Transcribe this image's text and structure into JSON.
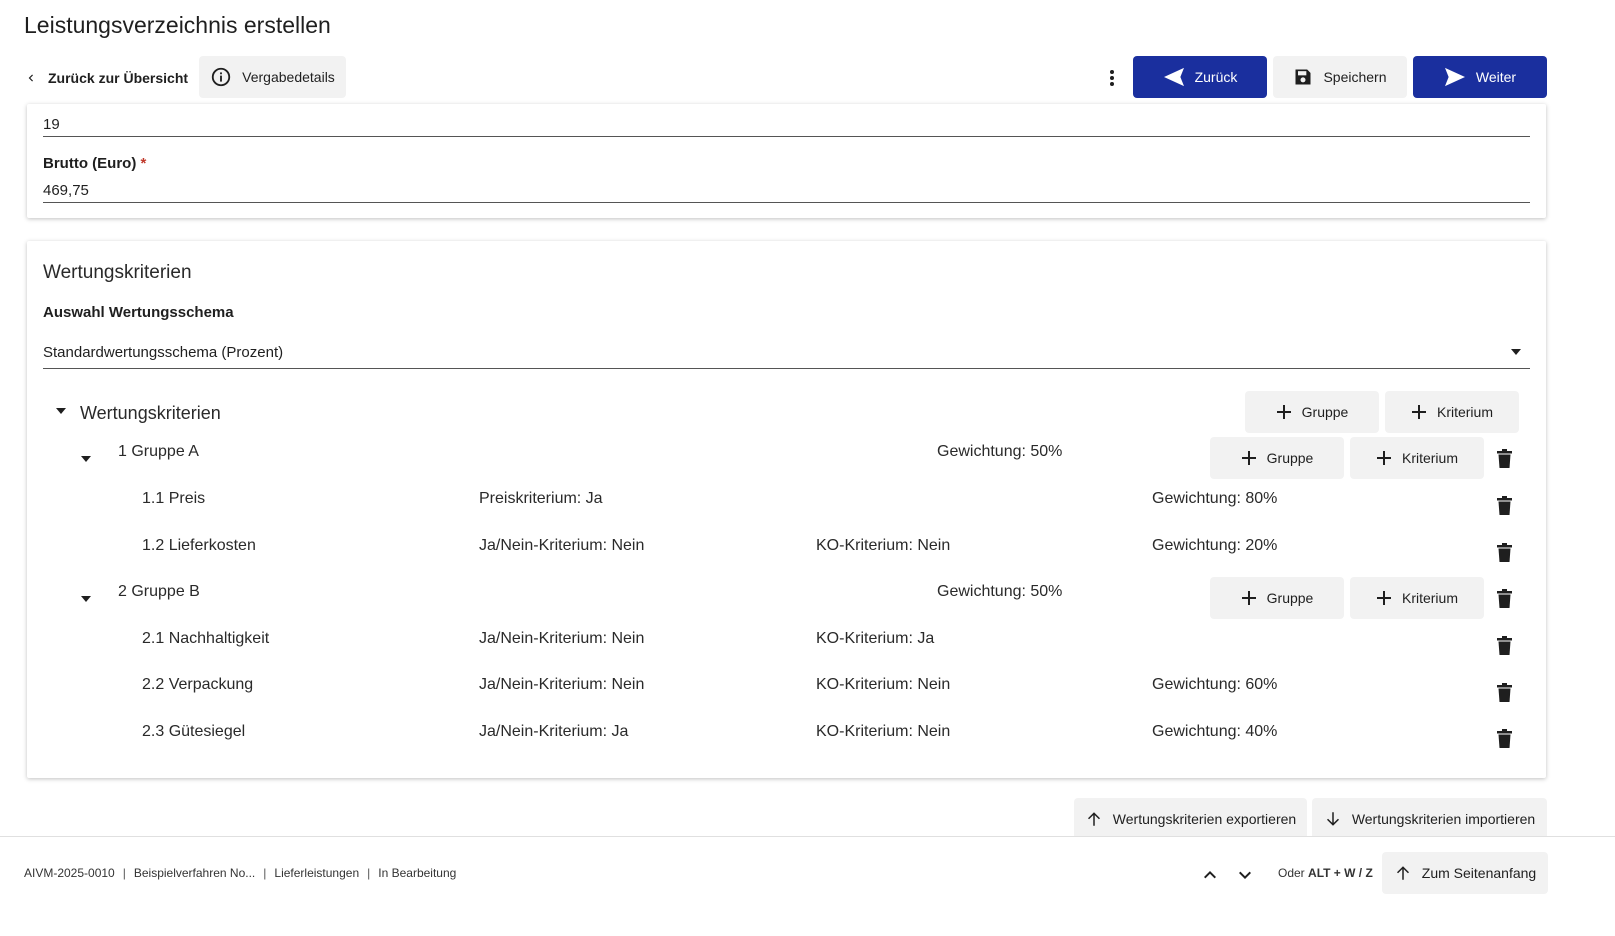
{
  "header": {
    "title": "Leistungsverzeichnis erstellen",
    "back_label": "Zurück zur Übersicht",
    "vergabedetails_label": "Vergabedetails",
    "zurueck_label": "Zurück",
    "speichern_label": "Speichern",
    "weiter_label": "Weiter"
  },
  "price_card": {
    "tax_value": "19",
    "brutto_label": "Brutto (Euro)",
    "required_mark": "*",
    "brutto_value": "469,75"
  },
  "criteria_card": {
    "title": "Wertungskriterien",
    "schema_label": "Auswahl Wertungsschema",
    "schema_value": "Standardwertungsschema (Prozent)",
    "root_label": "Wertungskriterien",
    "add_group_label": "Gruppe",
    "add_criterion_label": "Kriterium",
    "groups": [
      {
        "label": "1 Gruppe A",
        "weight": "Gewichtung: 50%",
        "criteria": [
          {
            "label": "1.1 Preis",
            "col1": "Preiskriterium: Ja",
            "col2": "",
            "weight": "Gewichtung: 80%"
          },
          {
            "label": "1.2 Lieferkosten",
            "col1": "Ja/Nein-Kriterium: Nein",
            "col2": "KO-Kriterium: Nein",
            "weight": "Gewichtung: 20%"
          }
        ]
      },
      {
        "label": "2 Gruppe B",
        "weight": "Gewichtung: 50%",
        "criteria": [
          {
            "label": "2.1 Nachhaltigkeit",
            "col1": "Ja/Nein-Kriterium: Nein",
            "col2": "KO-Kriterium: Ja",
            "weight": ""
          },
          {
            "label": "2.2 Verpackung",
            "col1": "Ja/Nein-Kriterium: Nein",
            "col2": "KO-Kriterium: Nein",
            "weight": "Gewichtung: 60%"
          },
          {
            "label": "2.3 Gütesiegel",
            "col1": "Ja/Nein-Kriterium: Ja",
            "col2": "KO-Kriterium: Nein",
            "weight": "Gewichtung: 40%"
          }
        ]
      }
    ],
    "export_label": "Wertungskriterien exportieren",
    "import_label": "Wertungskriterien importieren"
  },
  "footer": {
    "id": "AIVM-2025-0010",
    "name": "Beispielverfahren No...",
    "type": "Lieferleistungen",
    "status": "In Bearbeitung",
    "shortcut_prefix": "Oder",
    "shortcut_keys": "ALT + W / Z",
    "top_label": "Zum Seitenanfang"
  }
}
